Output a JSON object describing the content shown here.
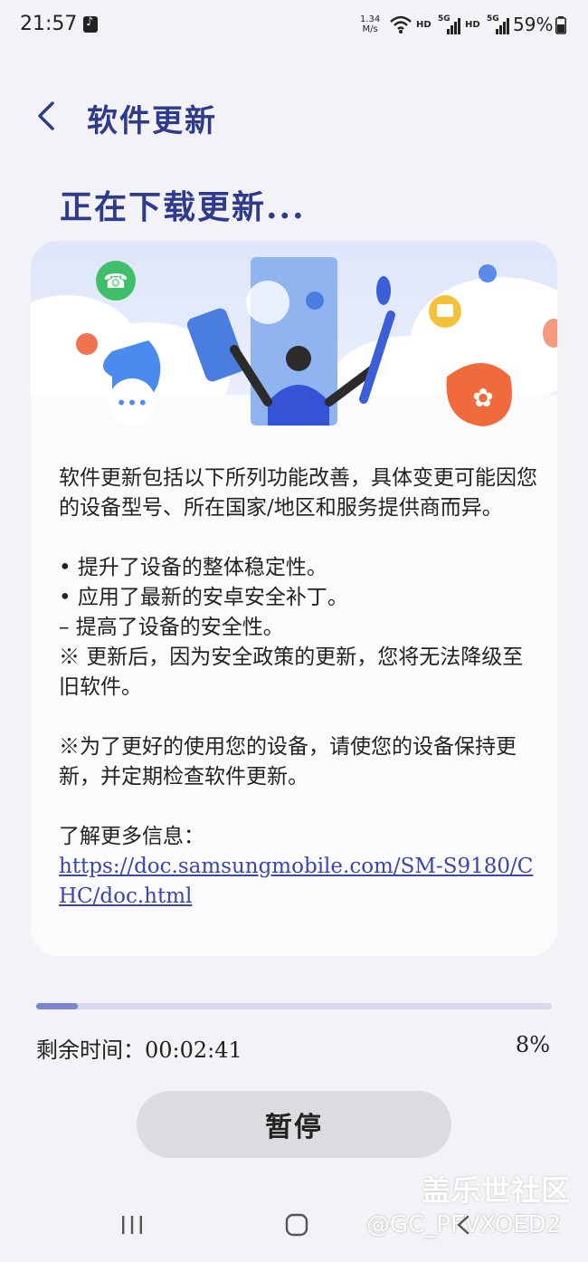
{
  "status_bar": {
    "time": "21:57",
    "speed_value": "1.34",
    "speed_unit": "M/s",
    "hd1": "HD",
    "hd2": "HD",
    "sim1": "5G",
    "sim2": "5G",
    "battery": "59%"
  },
  "header": {
    "title": "软件更新",
    "back_icon": "chevron-left-icon"
  },
  "heading": "正在下载更新...",
  "card": {
    "intro": "软件更新包括以下所列功能改善，具体变更可能因您的设备型号、所在国家/地区和服务提供商而异。",
    "bullet1": "• 提升了设备的整体稳定性。",
    "bullet2": "• 应用了最新的安卓安全补丁。",
    "bullet2_sub": " – 提高了设备的安全性。",
    "note1": "※ 更新后，因为安全政策的更新，您将无法降级至旧软件。",
    "note2": "※为了更好的使用您的设备，请使您的设备保持更新，并定期检查软件更新。",
    "more_label": "了解更多信息：",
    "link": "https://doc.samsungmobile.com/SM-S9180/CHC/doc.html"
  },
  "progress": {
    "fraction": 0.08,
    "remaining_label": "剩余时间：00:02:41",
    "percent_label": "8%"
  },
  "pause_button": "暂停",
  "watermark": {
    "line1": "盖乐世社区",
    "line2": "@GC_PFVXOED2"
  },
  "colors": {
    "accent": "#2e3a8c",
    "background": "#f3f2f7",
    "progress_fill": "#7c83cf",
    "progress_track": "#d9d8ee",
    "button_bg": "#dcdce0"
  },
  "nav_icons": [
    "recents-icon",
    "home-icon",
    "back-icon"
  ]
}
